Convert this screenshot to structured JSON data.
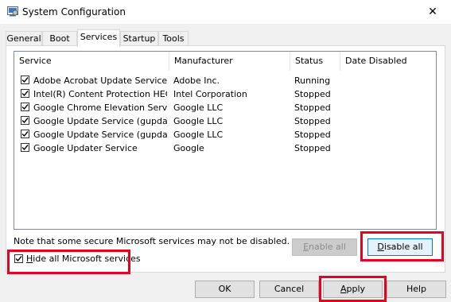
{
  "window": {
    "title": "System Configuration",
    "close_glyph": "✕",
    "app_icon": "system-config-icon"
  },
  "tabs": [
    "General",
    "Boot",
    "Services",
    "Startup",
    "Tools"
  ],
  "active_tab": "Services",
  "columns": [
    "Service",
    "Manufacturer",
    "Status",
    "Date Disabled"
  ],
  "services": [
    {
      "checked": true,
      "name": "Adobe Acrobat Update Service",
      "manufacturer": "Adobe Inc.",
      "status": "Running",
      "date": ""
    },
    {
      "checked": true,
      "name": "Intel(R) Content Protection HEC...",
      "manufacturer": "Intel Corporation",
      "status": "Stopped",
      "date": ""
    },
    {
      "checked": true,
      "name": "Google Chrome Elevation Servic...",
      "manufacturer": "Google LLC",
      "status": "Stopped",
      "date": ""
    },
    {
      "checked": true,
      "name": "Google Update Service (gupdate)",
      "manufacturer": "Google LLC",
      "status": "Stopped",
      "date": ""
    },
    {
      "checked": true,
      "name": "Google Update Service (gupdatem)",
      "manufacturer": "Google LLC",
      "status": "Stopped",
      "date": ""
    },
    {
      "checked": true,
      "name": "Google Updater Service",
      "manufacturer": "Google",
      "status": "Stopped",
      "date": ""
    }
  ],
  "note": "Note that some secure Microsoft services may not be disabled.",
  "buttons": {
    "enable_all_first": "E",
    "enable_all_rest": "nable all",
    "disable_all_first": "D",
    "disable_all_rest": "isable all",
    "ok": "OK",
    "cancel": "Cancel",
    "apply_first": "A",
    "apply_rest": "pply",
    "help": "Help"
  },
  "hide_ms": {
    "checked": true,
    "first": "H",
    "rest": "ide all Microsoft services"
  },
  "highlight_color": "#e8001c"
}
